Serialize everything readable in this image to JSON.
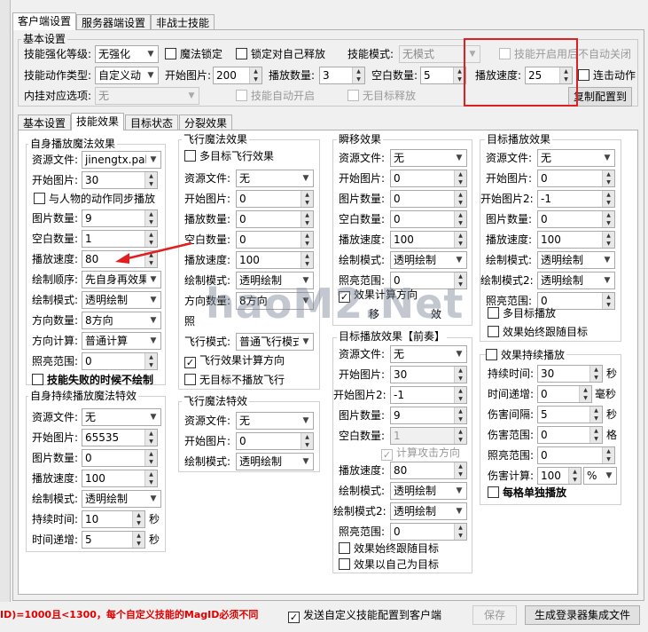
{
  "top_tabs": [
    "客户端设置",
    "服务器端设置",
    "非战士技能"
  ],
  "basic": {
    "title": "基本设置",
    "row1": {
      "enhance_label": "技能强化等级:",
      "enhance_value": "无强化",
      "magic_lock": "魔法锁定",
      "lock_self": "锁定对自己释放",
      "mode_label": "技能模式:",
      "mode_value": "无模式",
      "skill_on": "技能开启用后不自动关闭"
    },
    "row2": {
      "action_label": "技能动作类型:",
      "action_value": "自定义动",
      "start_label": "开始图片:",
      "start_value": "200",
      "count_label": "播放数量:",
      "count_value": "3",
      "blank_label": "空白数量:",
      "blank_value": "5",
      "speed_label": "播放速度:",
      "speed_value": "25",
      "combo": "连击动作"
    },
    "row3": {
      "plugin_label": "内挂对应选项:",
      "plugin_value": "无",
      "auto_on": "技能自动开启",
      "no_target": "无目标释放",
      "copy_btn": "复制配置到"
    }
  },
  "sub_tabs": [
    "基本设置",
    "技能效果",
    "目标状态",
    "分裂效果"
  ],
  "self_effect": {
    "title": "自身播放魔法效果",
    "res_label": "资源文件:",
    "res_value": "jinengtx.pak",
    "start_label": "开始图片:",
    "start_value": "30",
    "sync": "与人物的动作同步播放",
    "count_label": "图片数量:",
    "count_value": "9",
    "blank_label": "空白数量:",
    "blank_value": "1",
    "speed_label": "播放速度:",
    "speed_value": "80",
    "order_label": "绘制顺序:",
    "order_value": "先自身再效果",
    "mode_label": "绘制模式:",
    "mode_value": "透明绘制",
    "dir_label": "方向数量:",
    "dir_value": "8方向",
    "calc_label": "方向计算:",
    "calc_value": "普通计算",
    "light_label": "照亮范围:",
    "light_value": "0",
    "fail_nodraw": "技能失败的时候不绘制"
  },
  "self_persist": {
    "title": "自身持续播放魔法特效",
    "res_label": "资源文件:",
    "res_value": "无",
    "start_label": "开始图片:",
    "start_value": "65535",
    "count_label": "图片数量:",
    "count_value": "0",
    "speed_label": "播放速度:",
    "speed_value": "100",
    "mode_label": "绘制模式:",
    "mode_value": "透明绘制",
    "dur_label": "持续时间:",
    "dur_value": "10",
    "dur_unit": "秒",
    "inc_label": "时间递增:",
    "inc_value": "5",
    "inc_unit": "秒"
  },
  "fly_effect": {
    "title": "飞行魔法效果",
    "multi": "多目标飞行效果",
    "res_label": "资源文件:",
    "res_value": "无",
    "start_label": "开始图片:",
    "start_value": "0",
    "count_label": "播放数量:",
    "count_value": "0",
    "blank_label": "空白数量:",
    "blank_value": "0",
    "speed_label": "播放速度:",
    "speed_value": "100",
    "mode_label": "绘制模式:",
    "mode_value": "透明绘制",
    "dir_label": "方向数量:",
    "dir_value": "8方向",
    "light_label": "照",
    "fly_mode_label": "飞行模式:",
    "fly_mode_value": "普通飞行模式",
    "calc_dir": "飞行效果计算方向",
    "no_target_nofly": "无目标不播放飞行"
  },
  "fly_special": {
    "title": "飞行魔法特效",
    "res_label": "资源文件:",
    "res_value": "无",
    "start_label": "开始图片:",
    "start_value": "0",
    "mode_label": "绘制模式:",
    "mode_value": "透明绘制"
  },
  "teleport": {
    "title": "瞬移效果",
    "res_label": "资源文件:",
    "res_value": "无",
    "start_label": "开始图片:",
    "start_value": "0",
    "count_label": "图片数量:",
    "count_value": "0",
    "blank_label": "空白数量:",
    "blank_value": "0",
    "speed_label": "播放速度:",
    "speed_value": "100",
    "mode_label": "绘制模式:",
    "mode_value": "透明绘制",
    "light_label": "照亮范围:",
    "light_value": "0",
    "calc_dir": "效果计算方向",
    "move_partial": "移",
    "move_partial2": "效"
  },
  "target_effect": {
    "title": "目标播放效果",
    "title_extra": "【前奏】",
    "res_label": "资源文件:",
    "res_value": "无",
    "start_label": "开始图片:",
    "start_value": "30",
    "start2_label": "开始图片2:",
    "start2_value": "-1",
    "count_label": "图片数量:",
    "count_value": "9",
    "blank_label": "空白数量:",
    "blank_value": "1",
    "calc_attack": "计算攻击方向",
    "speed_label": "播放速度:",
    "speed_value": "80",
    "mode_label": "绘制模式:",
    "mode_value": "透明绘制",
    "mode2_label": "绘制模式2:",
    "mode2_value": "透明绘制",
    "light_label": "照亮范围:",
    "light_value": "0",
    "follow": "效果始终跟随目标",
    "self_target": "效果以自己为目标"
  },
  "target_play": {
    "title": "目标播放效果",
    "res_label": "资源文件:",
    "res_value": "无",
    "start_label": "开始图片:",
    "start_value": "0",
    "start2_label": "开始图片2:",
    "start2_value": "-1",
    "count_label": "图片数量:",
    "count_value": "0",
    "speed_label": "播放速度:",
    "speed_value": "100",
    "mode_label": "绘制模式:",
    "mode_value": "透明绘制",
    "mode2_label": "绘制模式2:",
    "mode2_value": "透明绘制",
    "light_label": "照亮范围:",
    "light_value": "0",
    "multi": "多目标播放",
    "follow": "效果始终跟随目标"
  },
  "persist": {
    "title": "效果持续播放",
    "dur_label": "持续时间:",
    "dur_value": "30",
    "dur_unit": "秒",
    "inc_label": "时间递增:",
    "inc_value": "0",
    "inc_unit": "毫秒",
    "interval_label": "伤害间隔:",
    "interval_value": "5",
    "interval_unit": "秒",
    "range_label": "伤害范围:",
    "range_value": "0",
    "range_unit": "格",
    "light_label": "照亮范围:",
    "light_value": "0",
    "calc_label": "伤害计算:",
    "calc_value": "100",
    "calc_unit": "%",
    "each": "每格单独播放"
  },
  "footer": {
    "warning": "ID)=1000且<1300，每个自定义技能的MagID必须不同",
    "send_config": "发送自定义技能配置到客户端",
    "save_btn": "保存",
    "gen_btn": "生成登录器集成文件"
  },
  "watermark": "haoM2.Net",
  "colors": {
    "highlight_red": "#e02020",
    "warning_red": "#e00000"
  }
}
